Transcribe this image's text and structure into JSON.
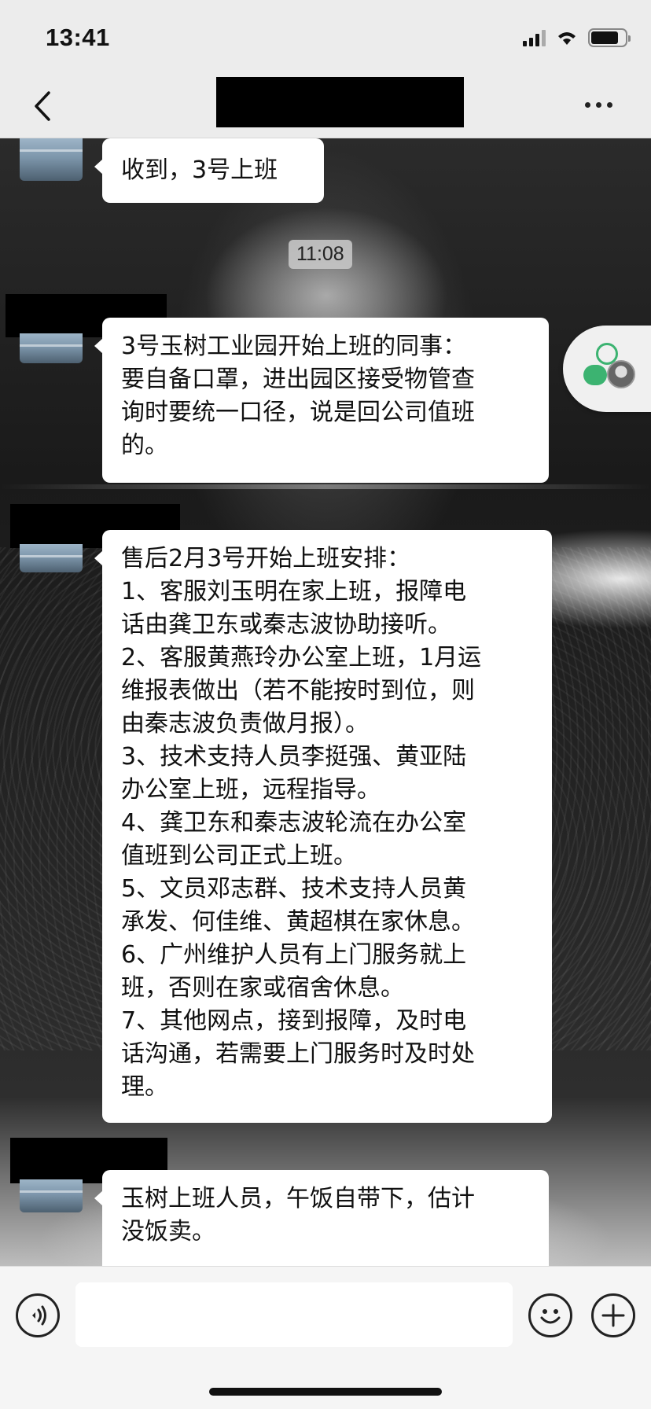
{
  "status_bar": {
    "time": "13:41"
  },
  "chat": {
    "timestamp": "11:08",
    "messages": [
      {
        "text": "收到，3号上班"
      },
      {
        "text": "3号玉树工业园开始上班的同事：\n要自备口罩，进出园区接受物管查\n询时要统一口径，说是回公司值班\n的。"
      },
      {
        "text": "售后2月3号开始上班安排：\n1、客服刘玉明在家上班，报障电\n话由龚卫东或秦志波协助接听。\n2、客服黄燕玲办公室上班，1月运\n维报表做出（若不能按时到位，则\n由秦志波负责做月报）。\n3、技术支持人员李挺强、黄亚陆\n办公室上班，远程指导。\n4、龚卫东和秦志波轮流在办公室\n值班到公司正式上班。\n5、文员邓志群、技术支持人员黄\n承发、何佳维、黄超棋在家休息。\n6、广州维护人员有上门服务就上\n班，否则在家或宿舍休息。\n7、其他网点，接到报障，及时电\n话沟通，若需要上门服务时及时处\n理。"
      },
      {
        "text": "玉树上班人员，午饭自带下，估计\n没饭卖。"
      }
    ]
  },
  "icons": {
    "back": "chevron-left-icon",
    "more": "more-dots-icon",
    "voice": "voice-icon",
    "emoji": "emoji-icon",
    "plus": "plus-icon"
  },
  "colors": {
    "bubble": "#ffffff",
    "header": "#ececec",
    "widget_green": "#3cb371"
  }
}
